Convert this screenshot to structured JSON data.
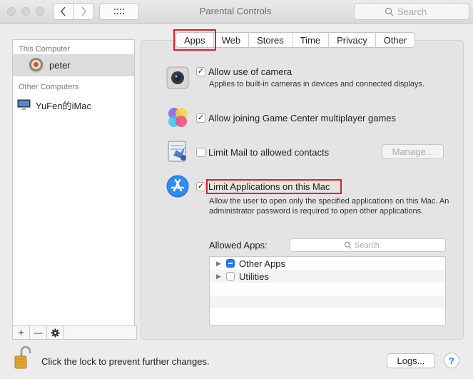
{
  "window": {
    "title": "Parental Controls",
    "search_placeholder": "Search"
  },
  "sidebar": {
    "this_computer_header": "This Computer",
    "current_user": "peter",
    "other_computers_header": "Other Computers",
    "other_computer": "YuFen的iMac",
    "toolbar": {
      "add": "+",
      "remove": "—"
    }
  },
  "tabs": [
    {
      "label": "Apps",
      "active": true
    },
    {
      "label": "Web"
    },
    {
      "label": "Stores"
    },
    {
      "label": "Time"
    },
    {
      "label": "Privacy"
    },
    {
      "label": "Other"
    }
  ],
  "options": {
    "camera": {
      "label": "Allow use of camera",
      "description": "Applies to built-in cameras in devices and connected displays.",
      "checked": true
    },
    "game_center": {
      "label": "Allow joining Game Center multiplayer games",
      "checked": true
    },
    "mail": {
      "label": "Limit Mail to allowed contacts",
      "checked": false,
      "button": "Manage..."
    },
    "limit_apps": {
      "label": "Limit Applications on this Mac",
      "description": "Allow the user to open only the specified applications on this Mac. An administrator password is required to open other applications.",
      "checked": true
    }
  },
  "allowed_apps": {
    "label": "Allowed Apps:",
    "search_placeholder": "Search",
    "items": [
      {
        "name": "Other Apps",
        "state": "mixed"
      },
      {
        "name": "Utilities",
        "state": "unchecked"
      }
    ]
  },
  "footer": {
    "lock_text": "Click the lock to prevent further changes.",
    "logs_button": "Logs...",
    "help": "?"
  },
  "colors": {
    "highlight": "#e0202a",
    "accent": "#2b7cf0"
  }
}
